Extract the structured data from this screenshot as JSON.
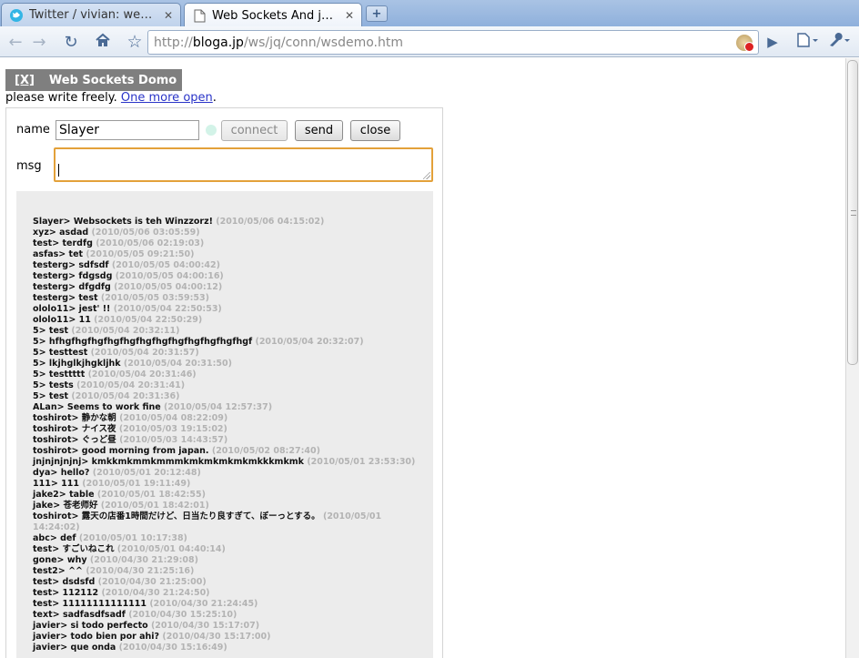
{
  "browser": {
    "tabs": [
      {
        "title": "Twitter / vivian: web s...",
        "favicon": "twitter-bird-icon",
        "active": false
      },
      {
        "title": "Web Sockets And jQ...",
        "favicon": "page-icon",
        "active": true
      }
    ],
    "address": {
      "scheme": "http://",
      "host": "bloga.jp",
      "path": "/ws/jq/conn/wsdemo.htm"
    }
  },
  "page": {
    "header_close": "[X]",
    "header_title": "Web Sockets Domo",
    "intro_text": "please write freely. ",
    "intro_link": "One more open",
    "intro_end": ".",
    "name_label": "name",
    "name_value": "Slayer",
    "msg_label": "msg",
    "connect_label": "connect",
    "send_label": "send",
    "close_label": "close"
  },
  "log": [
    {
      "user": "Slayer",
      "text": "Websockets is teh Winzzorz!",
      "time": "(2010/05/06 04:15:02)"
    },
    {
      "user": "xyz",
      "text": "asdad",
      "time": "(2010/05/06 03:05:59)"
    },
    {
      "user": "test",
      "text": "terdfg",
      "time": "(2010/05/06 02:19:03)"
    },
    {
      "user": "asfas",
      "text": "tet",
      "time": "(2010/05/05 09:21:50)"
    },
    {
      "user": "testerg",
      "text": "sdfsdf",
      "time": "(2010/05/05 04:00:42)"
    },
    {
      "user": "testerg",
      "text": "fdgsdg",
      "time": "(2010/05/05 04:00:16)"
    },
    {
      "user": "testerg",
      "text": "dfgdfg",
      "time": "(2010/05/05 04:00:12)"
    },
    {
      "user": "testerg",
      "text": "test",
      "time": "(2010/05/05 03:59:53)"
    },
    {
      "user": "ololo11",
      "text": "jest' !!",
      "time": "(2010/05/04 22:50:53)"
    },
    {
      "user": "ololo11",
      "text": "11",
      "time": "(2010/05/04 22:50:29)"
    },
    {
      "user": "5",
      "text": "test",
      "time": "(2010/05/04 20:32:11)"
    },
    {
      "user": "5",
      "text": "hfhgfhgfhgfhgfhgfhgfhgfhgfhgfhgfhgfhgf",
      "time": "(2010/05/04 20:32:07)"
    },
    {
      "user": "5",
      "text": "testtest",
      "time": "(2010/05/04 20:31:57)"
    },
    {
      "user": "5",
      "text": "lkjhglkjhgkljhk",
      "time": "(2010/05/04 20:31:50)"
    },
    {
      "user": "5",
      "text": "testtttt",
      "time": "(2010/05/04 20:31:46)"
    },
    {
      "user": "5",
      "text": "tests",
      "time": "(2010/05/04 20:31:41)"
    },
    {
      "user": "5",
      "text": "test",
      "time": "(2010/05/04 20:31:36)"
    },
    {
      "user": "ALan",
      "text": "Seems to work fine",
      "time": "(2010/05/04 12:57:37)"
    },
    {
      "user": "toshirot",
      "text": "静かな朝",
      "time": "(2010/05/04 08:22:09)"
    },
    {
      "user": "toshirot",
      "text": "ナイス夜",
      "time": "(2010/05/03 19:15:02)"
    },
    {
      "user": "toshirot",
      "text": "ぐっど昼",
      "time": "(2010/05/03 14:43:57)"
    },
    {
      "user": "toshirot",
      "text": "good morning from japan.",
      "time": "(2010/05/02 08:27:40)"
    },
    {
      "user": "jnjnjnjnjnj",
      "text": "kmkkmkmmkmmmkmkmkmkmkmkkkmkmk",
      "time": "(2010/05/01 23:53:30)"
    },
    {
      "user": "dya",
      "text": "hello?",
      "time": "(2010/05/01 20:12:48)"
    },
    {
      "user": "111",
      "text": "111",
      "time": "(2010/05/01 19:11:49)"
    },
    {
      "user": "jake2",
      "text": "table",
      "time": "(2010/05/01 18:42:55)"
    },
    {
      "user": "jake",
      "text": "苍老师好",
      "time": "(2010/05/01 18:42:01)"
    },
    {
      "user": "toshirot",
      "text": "露天の店番1時間だけど、日当たり良すぎて、ぼーっとする。",
      "time": "(2010/05/01 14:24:02)"
    },
    {
      "user": "abc",
      "text": "def",
      "time": "(2010/05/01 10:17:38)"
    },
    {
      "user": "test",
      "text": "すごいねこれ",
      "time": "(2010/05/01 04:40:14)"
    },
    {
      "user": "gone",
      "text": "why",
      "time": "(2010/04/30 21:29:08)"
    },
    {
      "user": "test2",
      "text": "^^",
      "time": "(2010/04/30 21:25:16)"
    },
    {
      "user": "test",
      "text": "dsdsfd",
      "time": "(2010/04/30 21:25:00)"
    },
    {
      "user": "test",
      "text": "112112",
      "time": "(2010/04/30 21:24:50)"
    },
    {
      "user": "test",
      "text": "11111111111111",
      "time": "(2010/04/30 21:24:45)"
    },
    {
      "user": "text",
      "text": "sadfasdfsadf",
      "time": "(2010/04/30 15:25:10)"
    },
    {
      "user": "javier",
      "text": "si todo perfecto",
      "time": "(2010/04/30 15:17:07)"
    },
    {
      "user": "javier",
      "text": "todo bien por ahi?",
      "time": "(2010/04/30 15:17:00)"
    },
    {
      "user": "javier",
      "text": "que onda",
      "time": "(2010/04/30 15:16:49)"
    }
  ]
}
